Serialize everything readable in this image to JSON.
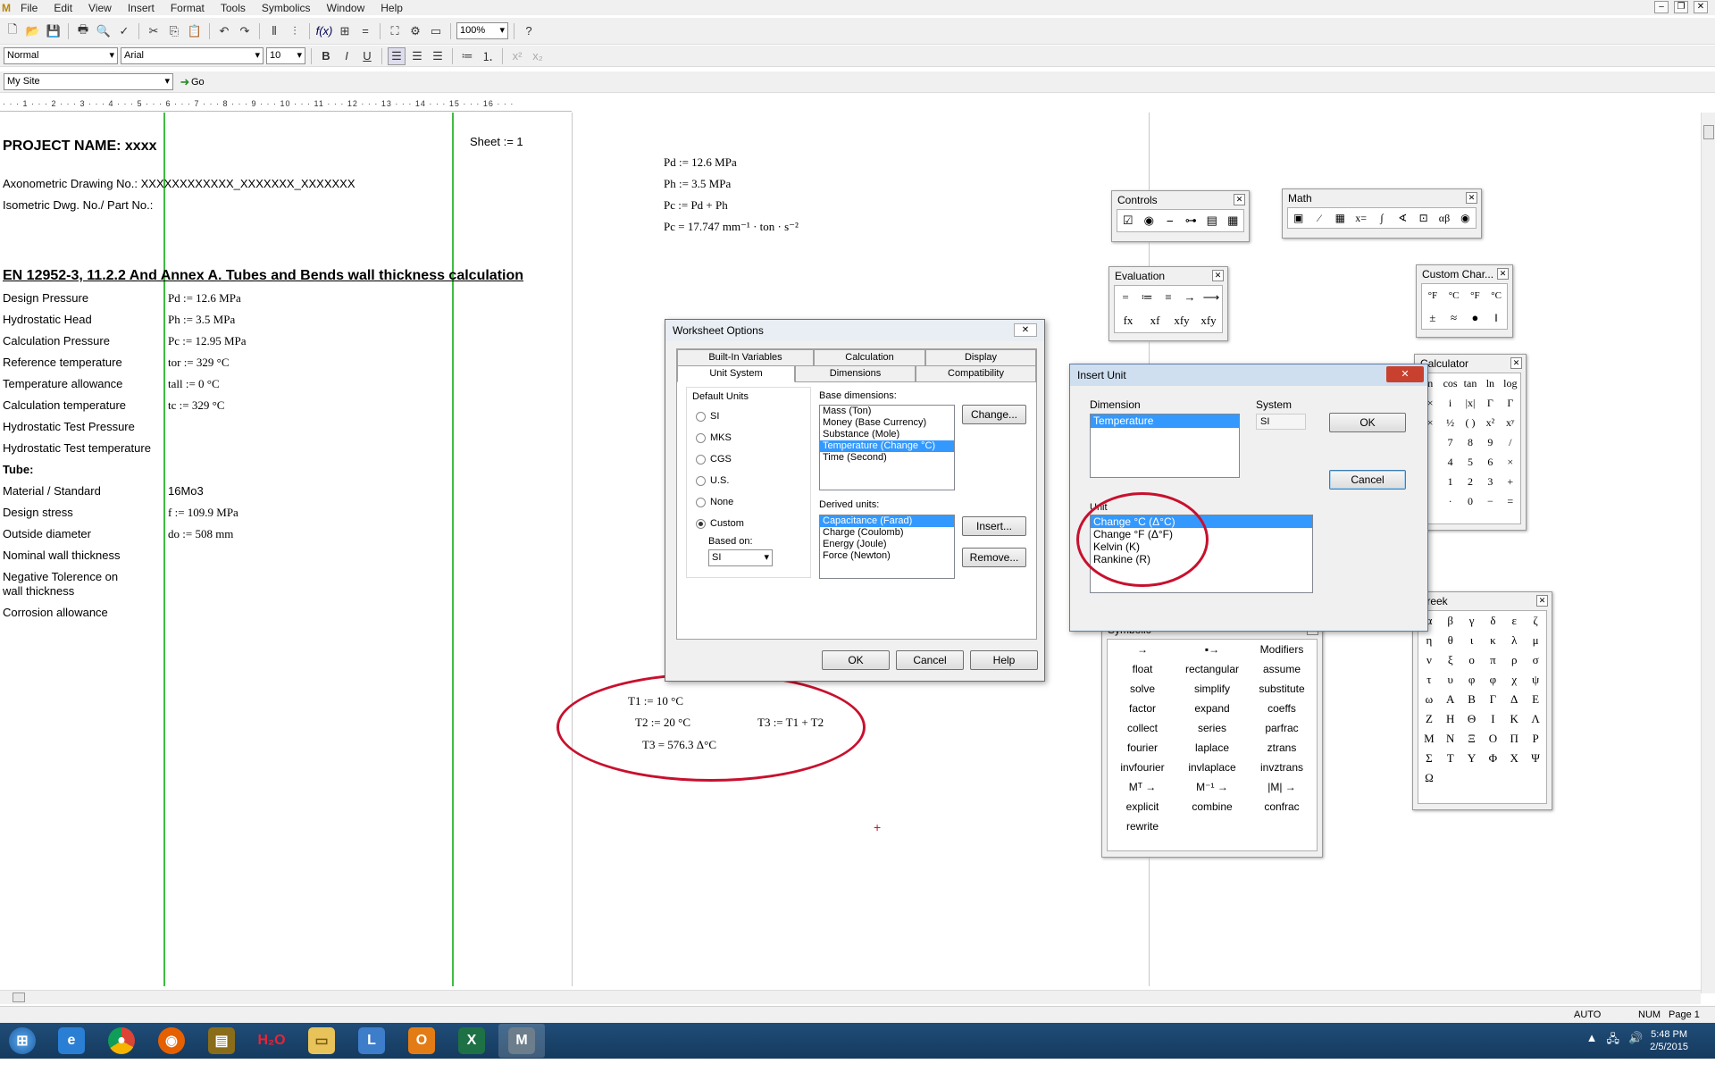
{
  "menu": [
    "File",
    "Edit",
    "View",
    "Insert",
    "Format",
    "Tools",
    "Symbolics",
    "Window",
    "Help"
  ],
  "toolbar": {
    "zoom": "100%",
    "style": "Normal",
    "font": "Arial",
    "size": "10",
    "site": "My Site",
    "go": "Go",
    "bold": "B",
    "italic": "I",
    "underline": "U"
  },
  "ruler": "·  ·  ·  1  ·  ·  ·  2  ·  ·  ·  3  ·  ·  ·  4  ·  ·  ·  5  ·  ·  ·  6  ·  ·  ·  7  ·  ·  ·  8  ·  ·  ·  9  ·  ·  ·  10  ·  ·  ·  11  ·  ·  ·  12  ·  ·  ·  13  ·  ·  ·  14  ·  ·  ·  15  ·  ·  ·  16  ·  ·  ·",
  "worksheet": {
    "project": "PROJECT NAME: xxxx",
    "sheet": "Sheet := 1",
    "axono": "Axonometric Drawing No.: XXXXXXXXXXXX_XXXXXXX_XXXXXXX",
    "iso": "Isometric Dwg. No./ Part No.:",
    "heading": "EN 12952-3, 11.2.2 And Annex A. Tubes and  Bends wall thickness calculation",
    "rows": [
      {
        "label": "Design Pressure",
        "value": "Pd := 12.6 MPa"
      },
      {
        "label": "Hydrostatic Head",
        "value": "Ph := 3.5 MPa"
      },
      {
        "label": "Calculation Pressure",
        "value": "Pc := 12.95 MPa"
      },
      {
        "label": "Reference temperature",
        "value": "tor := 329 °C"
      },
      {
        "label": "Temperature allowance",
        "value": "tall := 0 °C"
      },
      {
        "label": "Calculation temperature",
        "value": "tc := 329 °C"
      },
      {
        "label": "Hydrostatic Test Pressure",
        "value": ""
      },
      {
        "label": "Hydrostatic Test temperature",
        "value": ""
      },
      {
        "label": "Tube:",
        "value": ""
      },
      {
        "label": "Material / Standard",
        "value": "16Mo3"
      },
      {
        "label": "Design stress",
        "value": "f := 109.9 MPa"
      },
      {
        "label": "Outside diameter",
        "value": "do := 508 mm"
      },
      {
        "label": "Nominal wall thickness",
        "value": ""
      },
      {
        "label": "Negative Tolerence on wall thickness",
        "value": ""
      },
      {
        "label": "Corrosion allowance",
        "value": ""
      }
    ],
    "right_eq": [
      "Pd := 12.6 MPa",
      "Ph := 3.5 MPa",
      "Pc := Pd + Ph",
      "Pc = 17.747 mm⁻¹ · ton · s⁻²"
    ],
    "t_eq": {
      "t1": "T1 := 10 °C",
      "t2": "T2 := 20 °C",
      "t3def": "T3 := T1 + T2",
      "t3": "T3 = 576.3 Δ°C"
    }
  },
  "controls": {
    "title": "Controls",
    "icons": [
      "☑",
      "◉",
      "⎯",
      "⊶",
      "▤",
      "▦"
    ]
  },
  "math": {
    "title": "Math",
    "icons": [
      "▣",
      "⁄",
      "▦",
      "x=",
      "∫",
      "∢",
      "⊡",
      "αβ",
      "◉"
    ]
  },
  "evaluation": {
    "title": "Evaluation",
    "row1": [
      "=",
      "≔",
      "≡",
      "→",
      "⟶"
    ],
    "row2": [
      "fx",
      "xf",
      "xfy",
      "xfy"
    ]
  },
  "customchar": {
    "title": "Custom Char...",
    "row1": [
      "°F",
      "°C",
      "°F",
      "°C"
    ],
    "row2": [
      "±",
      "≈",
      "●",
      "‖"
    ]
  },
  "calculator": {
    "title": "Calculator",
    "rows": [
      [
        "n",
        "cos",
        "tan",
        "ln",
        "log"
      ],
      [
        "×",
        "i",
        "|x|",
        "Γ",
        "Γ"
      ],
      [
        "×",
        "½",
        "( )",
        "x²",
        "xʸ"
      ],
      [
        "",
        "7",
        "8",
        "9",
        "/"
      ],
      [
        "",
        "4",
        "5",
        "6",
        "×"
      ],
      [
        "",
        "1",
        "2",
        "3",
        "+"
      ],
      [
        "",
        "·",
        "0",
        "−",
        "="
      ]
    ]
  },
  "greek": {
    "title": "Greek",
    "rows": [
      [
        "α",
        "β",
        "γ",
        "δ",
        "ε",
        "ζ"
      ],
      [
        "η",
        "θ",
        "ι",
        "κ",
        "λ",
        "μ"
      ],
      [
        "ν",
        "ξ",
        "ο",
        "π",
        "ρ",
        "σ"
      ],
      [
        "τ",
        "υ",
        "φ",
        "φ",
        "χ",
        "ψ"
      ],
      [
        "ω",
        "Α",
        "Β",
        "Γ",
        "Δ",
        "Ε"
      ],
      [
        "Ζ",
        "Η",
        "Θ",
        "Ι",
        "Κ",
        "Λ"
      ],
      [
        "Μ",
        "Ν",
        "Ξ",
        "Ο",
        "Π",
        "Ρ"
      ],
      [
        "Σ",
        "Τ",
        "Υ",
        "Φ",
        "Χ",
        "Ψ"
      ],
      [
        "Ω"
      ]
    ]
  },
  "symbolic": {
    "title": "Symbolic",
    "rows": [
      [
        "→",
        "▪→",
        "Modifiers"
      ],
      [
        "float",
        "rectangular",
        "assume"
      ],
      [
        "solve",
        "simplify",
        "substitute"
      ],
      [
        "factor",
        "expand",
        "coeffs"
      ],
      [
        "collect",
        "series",
        "parfrac"
      ],
      [
        "fourier",
        "laplace",
        "ztrans"
      ],
      [
        "invfourier",
        "invlaplace",
        "invztrans"
      ],
      [
        "Mᵀ →",
        "M⁻¹ →",
        "|M| →"
      ],
      [
        "explicit",
        "combine",
        "confrac"
      ],
      [
        "rewrite",
        "",
        ""
      ]
    ]
  },
  "worksheetOptions": {
    "title": "Worksheet Options",
    "tabs_top": [
      "Built-In Variables",
      "Calculation",
      "Display"
    ],
    "tabs_bottom": [
      "Unit System",
      "Dimensions",
      "Compatibility"
    ],
    "default_units": "Default Units",
    "radios": [
      "SI",
      "MKS",
      "CGS",
      "U.S.",
      "None",
      "Custom"
    ],
    "based_on": "Based on:",
    "based_value": "SI",
    "base_dims_label": "Base dimensions:",
    "base_dims": [
      "Mass (Ton)",
      "Money (Base Currency)",
      "Substance (Mole)",
      "Temperature (Change °C)",
      "Time (Second)"
    ],
    "derived_label": "Derived units:",
    "derived": [
      "Capacitance (Farad)",
      "Charge (Coulomb)",
      "Energy (Joule)",
      "Force (Newton)"
    ],
    "change": "Change...",
    "insert": "Insert...",
    "remove": "Remove...",
    "ok": "OK",
    "cancel": "Cancel",
    "help": "Help"
  },
  "insertUnit": {
    "title": "Insert Unit",
    "dimension_label": "Dimension",
    "dimension": "Temperature",
    "system_label": "System",
    "system": "SI",
    "unit_label": "Unit",
    "units": [
      "Change °C (Δ°C)",
      "Change °F (Δ°F)",
      "Kelvin (K)",
      "Rankine (R)"
    ],
    "ok": "OK",
    "cancel": "Cancel"
  },
  "status": {
    "auto": "AUTO",
    "num": "NUM",
    "page": "Page 1"
  },
  "clock": {
    "time": "5:48 PM",
    "date": "2/5/2015"
  },
  "colors": {
    "accent": "#3399ff",
    "mark": "#c8102e",
    "grid": "#3fbd3f"
  }
}
